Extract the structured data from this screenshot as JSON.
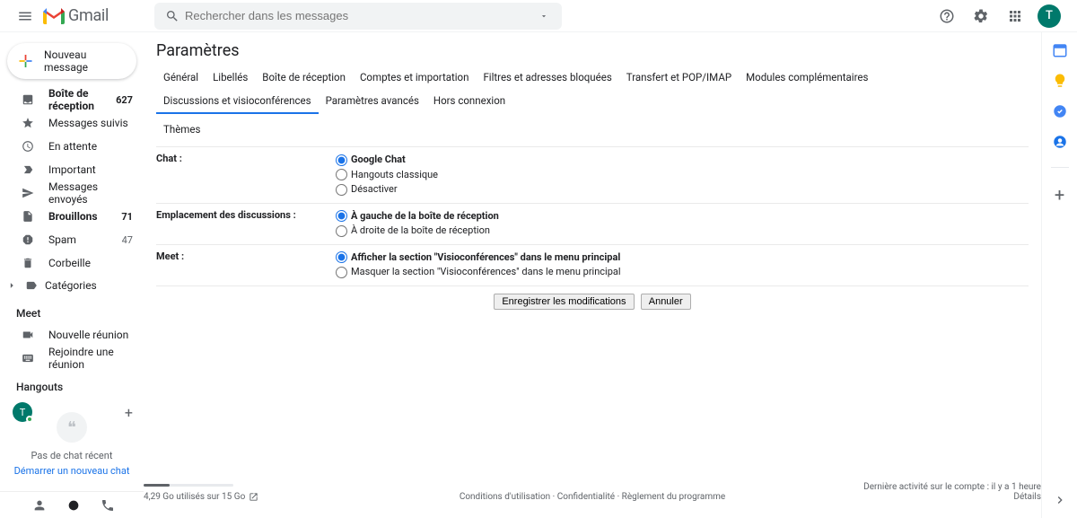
{
  "header": {
    "logo_text": "Gmail",
    "search_placeholder": "Rechercher dans les messages",
    "avatar_letter": "T"
  },
  "compose_label": "Nouveau message",
  "nav": [
    {
      "icon": "inbox",
      "label": "Boîte de réception",
      "count": "627",
      "bold": true
    },
    {
      "icon": "star",
      "label": "Messages suivis",
      "count": "",
      "bold": false
    },
    {
      "icon": "clock",
      "label": "En attente",
      "count": "",
      "bold": false
    },
    {
      "icon": "important",
      "label": "Important",
      "count": "",
      "bold": false
    },
    {
      "icon": "send",
      "label": "Messages envoyés",
      "count": "",
      "bold": false
    },
    {
      "icon": "draft",
      "label": "Brouillons",
      "count": "71",
      "bold": true
    },
    {
      "icon": "spam",
      "label": "Spam",
      "count": "47",
      "bold": false
    },
    {
      "icon": "trash",
      "label": "Corbeille",
      "count": "",
      "bold": false
    }
  ],
  "categories_label": "Catégories",
  "meet_section": {
    "title": "Meet",
    "new_meeting": "Nouvelle réunion",
    "join_meeting": "Rejoindre une réunion"
  },
  "hangouts_section": {
    "title": "Hangouts",
    "avatar_letter": "T"
  },
  "no_chat": {
    "line1": "Pas de chat récent",
    "line2": "Démarrer un nouveau chat"
  },
  "settings": {
    "title": "Paramètres",
    "tabs": [
      "Général",
      "Libellés",
      "Boîte de réception",
      "Comptes et importation",
      "Filtres et adresses bloquées",
      "Transfert et POP/IMAP",
      "Modules complémentaires",
      "Discussions et visioconférences",
      "Paramètres avancés",
      "Hors connexion"
    ],
    "tabs2": [
      "Thèmes"
    ],
    "active_tab": "Discussions et visioconférences",
    "rows": [
      {
        "label": "Chat :",
        "options": [
          {
            "text": "Google Chat",
            "selected": true
          },
          {
            "text": "Hangouts classique",
            "selected": false
          },
          {
            "text": "Désactiver",
            "selected": false
          }
        ]
      },
      {
        "label": "Emplacement des discussions :",
        "options": [
          {
            "text": "À gauche de la boîte de réception",
            "selected": true
          },
          {
            "text": "À droite de la boîte de réception",
            "selected": false
          }
        ]
      },
      {
        "label": "Meet :",
        "options": [
          {
            "text": "Afficher la section \"Visioconférences\" dans le menu principal",
            "selected": true
          },
          {
            "text": "Masquer la section \"Visioconférences\" dans le menu principal",
            "selected": false
          }
        ]
      }
    ],
    "save_btn": "Enregistrer les modifications",
    "cancel_btn": "Annuler"
  },
  "footer": {
    "storage_used": "4,29 Go utilisés sur 15 Go",
    "terms": "Conditions d'utilisation",
    "privacy": "Confidentialité",
    "program": "Règlement du programme",
    "activity": "Dernière activité sur le compte : il y a 1 heure",
    "details": "Détails"
  }
}
